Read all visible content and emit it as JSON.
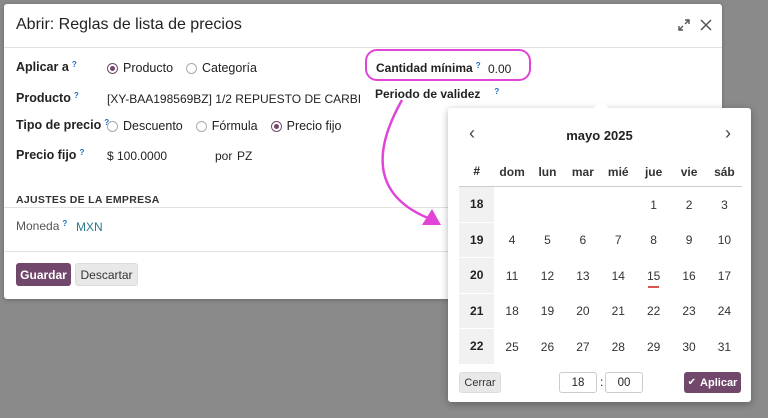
{
  "dialog": {
    "title": "Abrir: Reglas de lista de precios",
    "expand_icon": "expand-icon",
    "close_icon": "close-icon"
  },
  "form": {
    "apply_to": {
      "label": "Aplicar a",
      "tip": "?",
      "options": [
        "Producto",
        "Categoría"
      ],
      "selected": "Producto"
    },
    "product": {
      "label": "Producto",
      "tip": "?",
      "value": "[XY-BAA198569BZ] 1/2 REPUESTO DE CARBI"
    },
    "price_type": {
      "label": "Tipo de precio",
      "tip": "?",
      "options": [
        "Descuento",
        "Fórmula",
        "Precio fijo"
      ],
      "selected": "Precio fijo"
    },
    "fixed_price": {
      "label": "Precio fijo",
      "tip": "?",
      "value": "$ 100.0000",
      "per": "por",
      "unit": "PZ"
    },
    "min_qty": {
      "label": "Cantidad mínima",
      "tip": "?",
      "value": "0.00"
    },
    "validity": {
      "label": "Periodo de validez",
      "tip": "?"
    }
  },
  "company_section": {
    "title": "AJUSTES DE LA EMPRESA",
    "currency_label": "Moneda",
    "currency_tip": "?",
    "currency_value": "MXN"
  },
  "footer": {
    "save_label": "Guardar",
    "discard_label": "Descartar"
  },
  "calendar": {
    "month_title": "mayo 2025",
    "prev_icon": "chevron-left-icon",
    "next_icon": "chevron-right-icon",
    "week_header": "#",
    "weekdays": [
      "dom",
      "lun",
      "mar",
      "mié",
      "jue",
      "vie",
      "sáb"
    ],
    "weeks": [
      {
        "num": "18",
        "days": [
          "",
          "",
          "",
          "",
          "1",
          "2",
          "3"
        ]
      },
      {
        "num": "19",
        "days": [
          "4",
          "5",
          "6",
          "7",
          "8",
          "9",
          "10"
        ]
      },
      {
        "num": "20",
        "days": [
          "11",
          "12",
          "13",
          "14",
          "15",
          "16",
          "17"
        ]
      },
      {
        "num": "21",
        "days": [
          "18",
          "19",
          "20",
          "21",
          "22",
          "23",
          "24"
        ]
      },
      {
        "num": "22",
        "days": [
          "25",
          "26",
          "27",
          "28",
          "29",
          "30",
          "31"
        ]
      }
    ],
    "today": "15",
    "close_label": "Cerrar",
    "hour": "18",
    "minute": "00",
    "time_sep": ":",
    "apply_label": "Aplicar",
    "accent_color": "#71486b",
    "today_underline_color": "#d9534f"
  },
  "annotation": {
    "highlight_color": "#e045d8"
  }
}
